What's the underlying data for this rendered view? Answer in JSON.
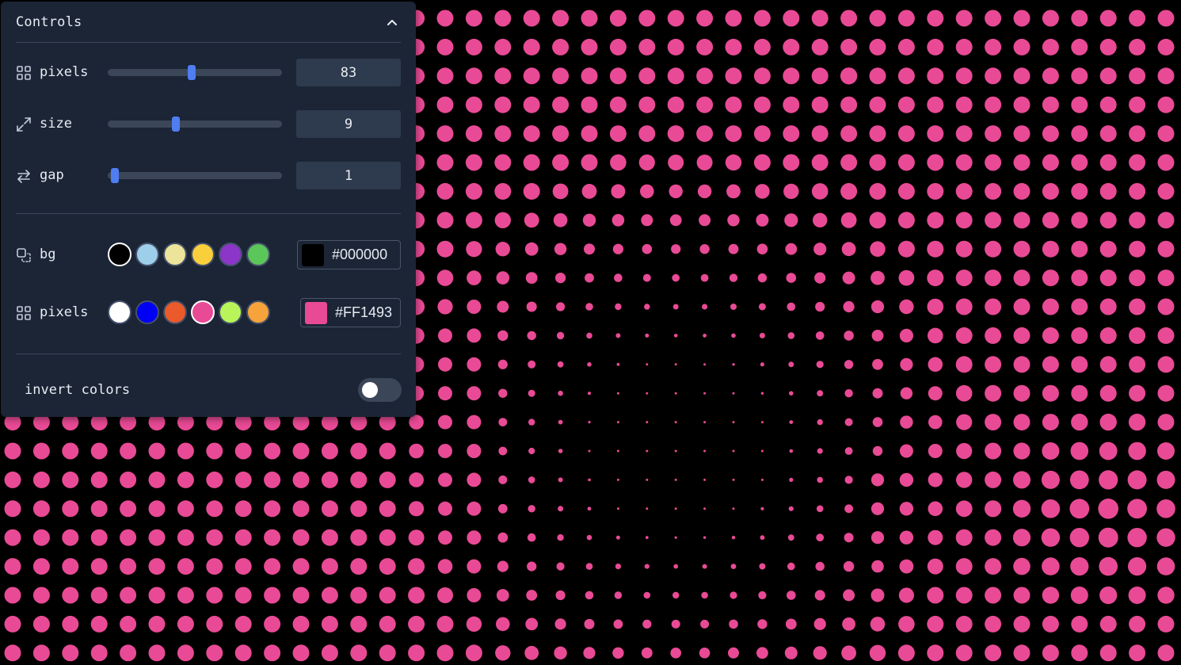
{
  "panel": {
    "title": "Controls",
    "collapse_icon": "chevron-up-icon"
  },
  "sliders": [
    {
      "id": "pixels",
      "label": "pixels",
      "icon": "grid-icon",
      "value": "83",
      "fraction": 0.48
    },
    {
      "id": "size",
      "label": "size",
      "icon": "expand-icon",
      "value": "9",
      "fraction": 0.39
    },
    {
      "id": "gap",
      "label": "gap",
      "icon": "swap-arrows-icon",
      "value": "1",
      "fraction": 0.04
    }
  ],
  "bg": {
    "label": "bg",
    "icon": "copy-dashed-icon",
    "hex": "#000000",
    "swatches": [
      "#000000",
      "#9ecfea",
      "#ece49a",
      "#f9cf3c",
      "#8b35c9",
      "#5bc65a"
    ],
    "selected_index": 0
  },
  "pixels_color": {
    "label": "pixels",
    "icon": "grid-icon",
    "hex": "#FF1493",
    "display_color": "#e94a95",
    "swatches": [
      "#ffffff",
      "#0000f5",
      "#ea5a2a",
      "#e94a95",
      "#b8f55a",
      "#f5a33a"
    ],
    "selected_index": 3
  },
  "invert": {
    "label": "invert colors",
    "on": false
  },
  "canvas": {
    "dot_color": "#e94a95",
    "background": "#000000"
  }
}
